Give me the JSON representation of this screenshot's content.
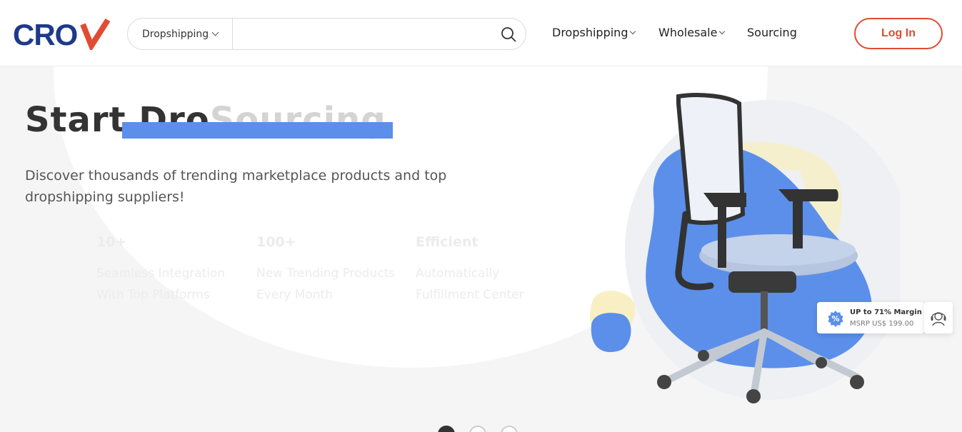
{
  "header": {
    "logo_text": "CROV",
    "search": {
      "category": "Dropshipping",
      "placeholder": "",
      "value": ""
    },
    "nav": [
      {
        "label": "Dropshipping",
        "has_dropdown": true
      },
      {
        "label": "Wholesale",
        "has_dropdown": true
      },
      {
        "label": "Sourcing",
        "has_dropdown": false
      }
    ],
    "login_label": "Log In"
  },
  "hero": {
    "title_visible": "Start Dro",
    "title_ghost": "Sourcing",
    "subtitle": "Discover thousands of trending marketplace products and top dropshipping suppliers!",
    "stats": [
      {
        "num": "10+",
        "desc": "Seamless Integration With Top Platforms"
      },
      {
        "num": "100+",
        "desc": "New Trending Products Every Month"
      },
      {
        "num": "Efficient",
        "desc": "Automatically Fulfillment Center"
      }
    ],
    "margin_card": {
      "line1": "UP to 71% Margin",
      "line2": "MSRP US$ 199.00"
    }
  },
  "carousel": {
    "active_index": 0,
    "count": 3
  },
  "colors": {
    "brand_red": "#e14b32",
    "brand_navy": "#1d3a8a",
    "accent_blue": "#5b8fea"
  },
  "icons": {
    "search": "search-icon",
    "support": "headset-icon",
    "badge": "percent-badge-icon"
  }
}
